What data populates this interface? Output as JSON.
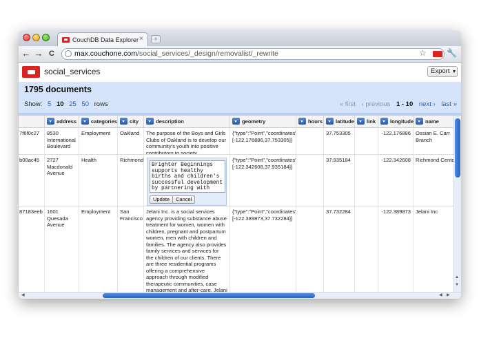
{
  "browser": {
    "tab_title": "CouchDB Data Explorer",
    "tab_close": "×",
    "new_tab": "+",
    "url_host": "max.couchone.com",
    "url_path": "/social_services/_design/removalist/_rewrite",
    "back": "←",
    "forward": "→",
    "reload": "C",
    "star": "☆",
    "wrench": "🔧"
  },
  "app": {
    "db_name": "social_services",
    "export_label": "Export",
    "export_caret": "▼"
  },
  "info": {
    "doc_count": "1795 documents",
    "show_label": "Show:",
    "page_sizes": [
      "5",
      "10",
      "25",
      "50"
    ],
    "rows_label": "rows",
    "pager": {
      "first": "« first",
      "previous": "‹ previous",
      "range": "1 - 10",
      "next": "next ›",
      "last": "last »"
    }
  },
  "table": {
    "columns": [
      "address",
      "categories",
      "city",
      "description",
      "geometry",
      "hours",
      "latitude",
      "link",
      "longitude",
      "name"
    ],
    "rows": [
      {
        "id": "7f6f0c27",
        "address": "8530 International Boulevard",
        "categories": "Employment",
        "city": "Oakland",
        "description": "The purpose of the Boys and Girls Clubs of Oakland is to develop our community's youth into positive contributors to society.",
        "geometry": "{\"type\":\"Point\",\"coordinates\":[-122.176886,37.753305]}",
        "hours": "",
        "latitude": "37.753305",
        "link": "",
        "longitude": "-122.176886",
        "name": "Ossian E. Carr Branch"
      },
      {
        "id": "b00ac45",
        "address": "2727 Macdonald Avenue",
        "categories": "Health",
        "city": "Richmond",
        "description": "",
        "geometry": "{\"type\":\"Point\",\"coordinates\":[-122.342608,37.935184]}",
        "hours": "",
        "latitude": "37.935184",
        "link": "",
        "longitude": "-122.342608",
        "name": "Richmond Center"
      },
      {
        "id": "87183eeb",
        "address": "1601 Quesada Avenue",
        "categories": "Employment",
        "city": "San Francisco",
        "description": "Jelani Inc. is a social services agency providing substance abuse treatment for women, women with children, pregnant and postpartum women, men with children and families. The agency also provides family services and services for the children of our clients. There are three residential programs offering a comprehensive approach through modified therapeutic communities, case management and after-care. Jelani Inc. believes in the right and ability of each individual to heal from substance abuse and dependence in",
        "geometry": "{\"type\":\"Point\",\"coordinates\":[-122.389873,37.732284]}",
        "hours": "",
        "latitude": "37.732284",
        "link": "",
        "longitude": "-122.389873",
        "name": "Jelani Inc"
      }
    ],
    "editor": {
      "text": "Brighter Beginnings supports healthy births and children's successful development by partnering with",
      "update_label": "Update",
      "cancel_label": "Cancel"
    }
  },
  "colors": {
    "accent": "#d8231f",
    "info_bar": "#d6e4fb",
    "link": "#2b5fbe",
    "scroll_thumb": "#2c63c3"
  }
}
